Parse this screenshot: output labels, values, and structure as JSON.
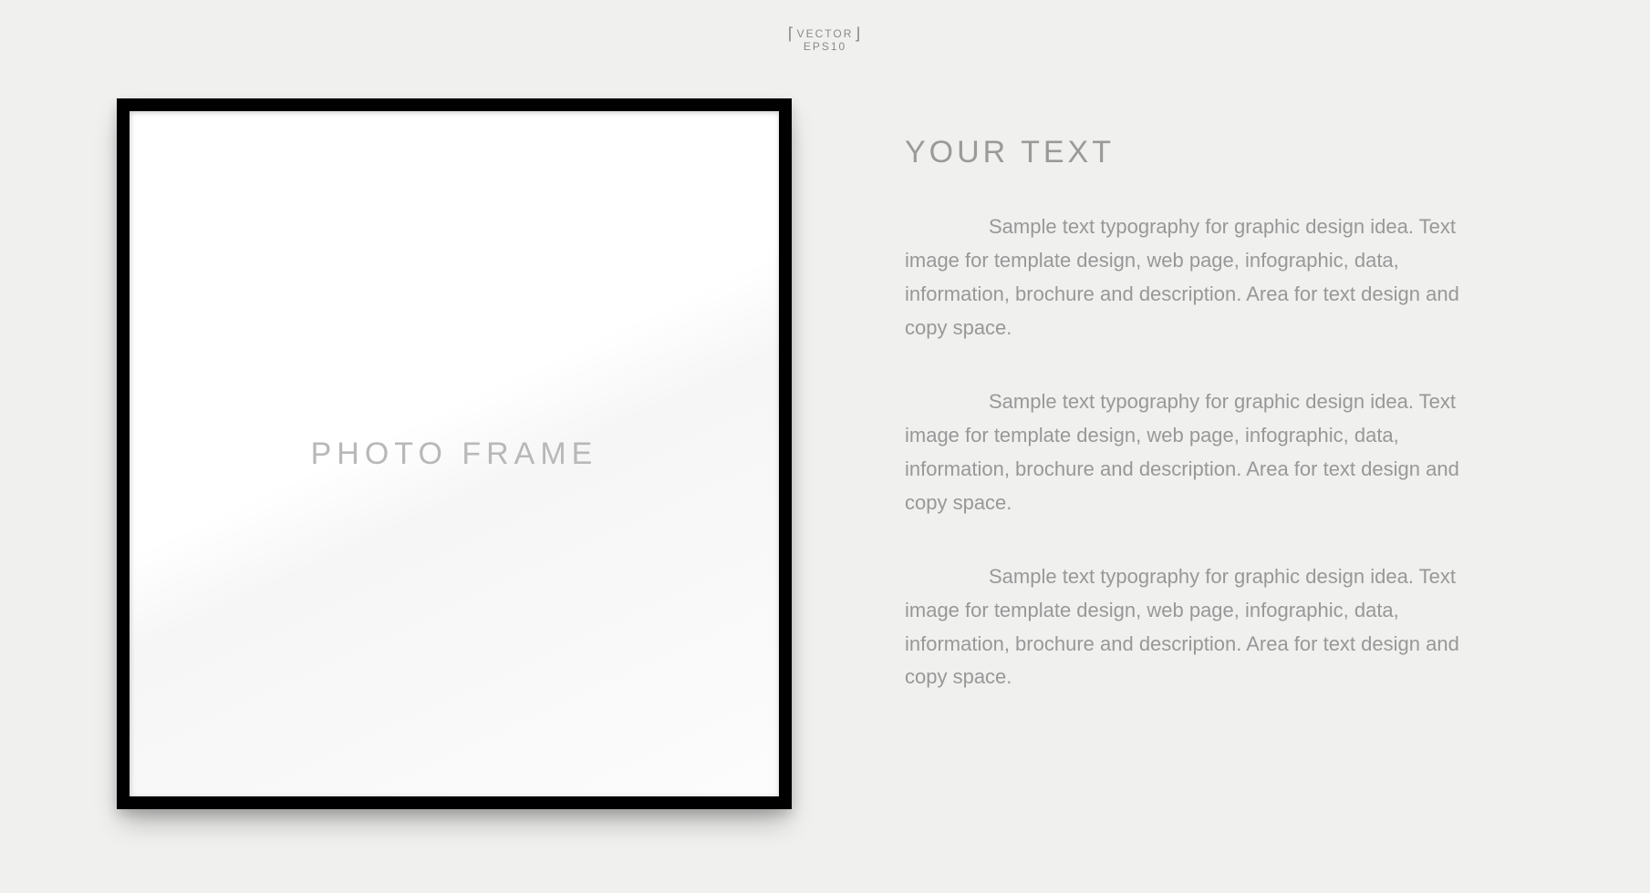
{
  "badge": {
    "line1": "VECTOR",
    "line2": "EPS10"
  },
  "frame": {
    "label": "PHOTO FRAME"
  },
  "text": {
    "heading": "YOUR TEXT",
    "paragraphs": [
      "Sample text typography for graphic design idea. Text image for template design, web page, infographic, data, information, brochure and description. Area for text design and copy space.",
      "Sample text typography for graphic design idea. Text image for template design, web page, infographic, data, information, brochure and description. Area for text design and copy space.",
      "Sample text typography for graphic design idea. Text image for template design, web page, infographic, data, information, brochure and description. Area for text design and copy space."
    ]
  }
}
